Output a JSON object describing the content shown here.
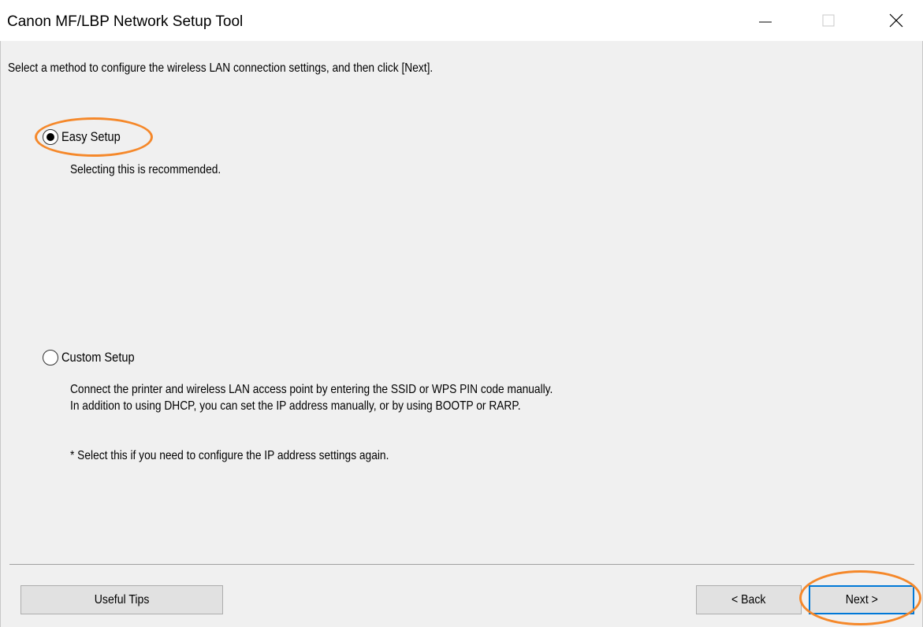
{
  "window": {
    "title": "Canon MF/LBP Network Setup Tool",
    "controls": {
      "minimize": "minimize-icon",
      "maximize": "maximize-icon",
      "close": "close-icon"
    }
  },
  "instruction": "Select a method to configure the wireless LAN connection settings, and then click [Next].",
  "options": [
    {
      "label": "Easy Setup",
      "selected": true,
      "description": [
        "Selecting this is recommended."
      ]
    },
    {
      "label": "Custom Setup",
      "selected": false,
      "description": [
        "Connect the printer and wireless LAN access point by entering the SSID or WPS PIN code manually.",
        "In addition to using DHCP, you can set the IP address manually, or by using BOOTP or RARP."
      ],
      "note": "* Select this if you need to configure the IP address settings again."
    }
  ],
  "buttons": {
    "useful_tips": "Useful Tips",
    "back": "< Back",
    "next": "Next >"
  },
  "colors": {
    "highlight": "#f5882a",
    "default_button_border": "#0078d7",
    "dialog_background": "#f0f0f0"
  }
}
